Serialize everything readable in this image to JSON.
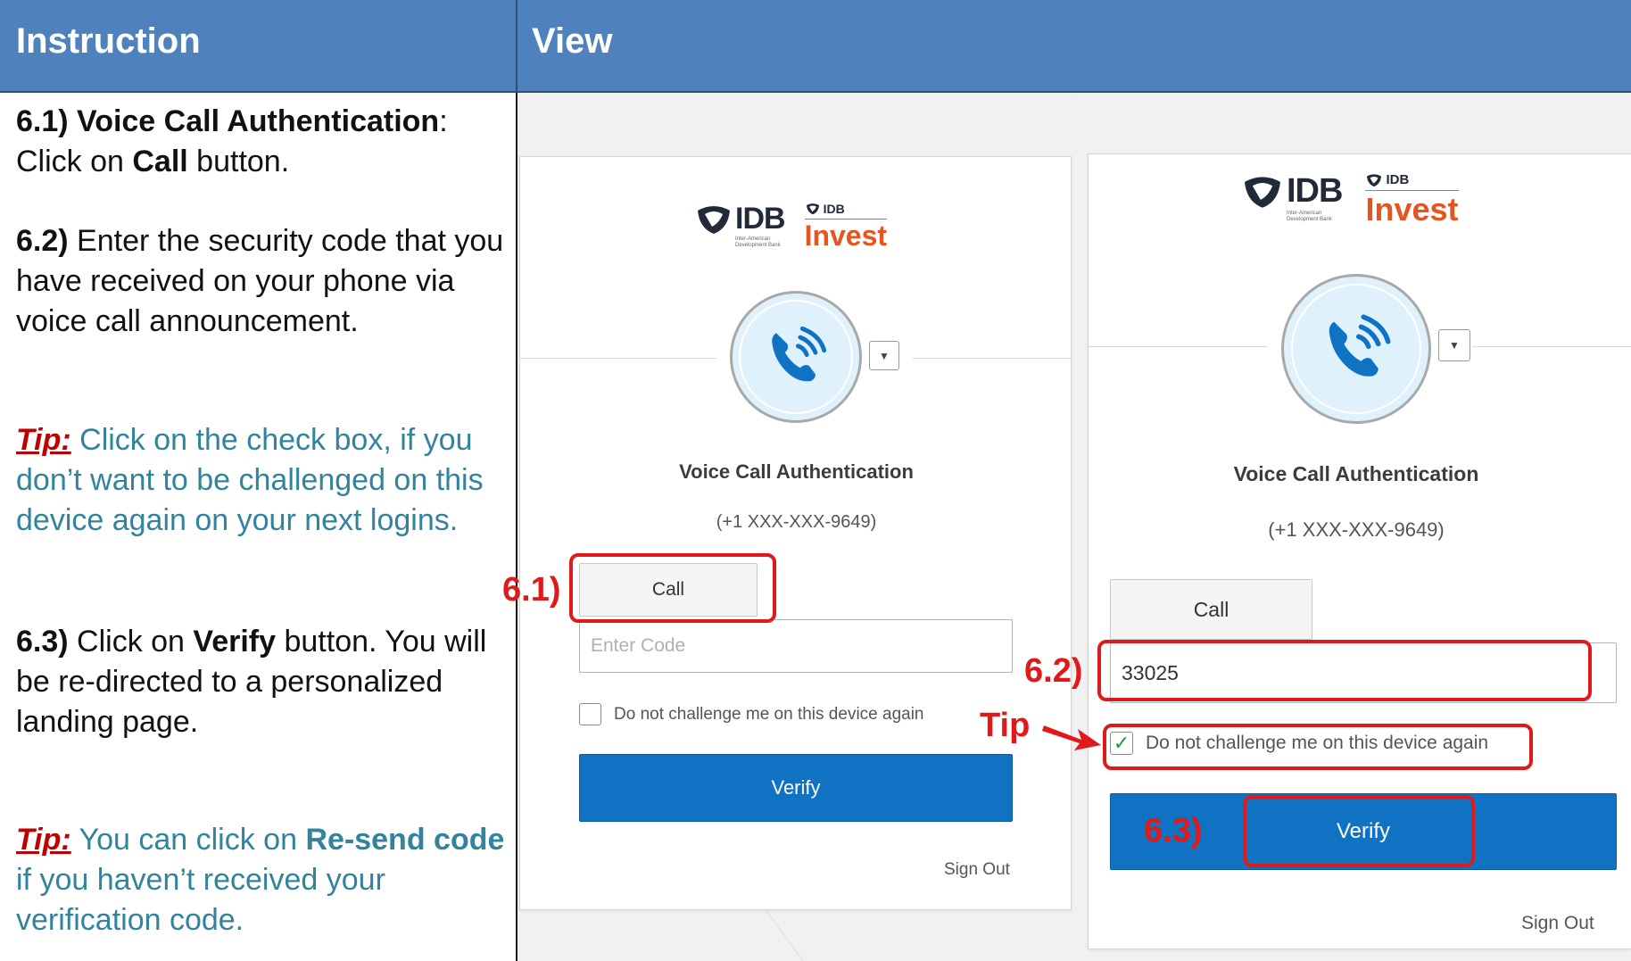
{
  "header": {
    "instruction": "Instruction",
    "view": "View"
  },
  "instructions": {
    "p1": {
      "step": "6.1) Voice Call Authentication",
      "colon": ":",
      "text1": "Click on ",
      "bold": "Call",
      "text2": " button."
    },
    "p2": {
      "step": "6.2)",
      "text": " Enter the security code that you have received on your phone via voice call announcement."
    },
    "p3": {
      "tip": "Tip:",
      "text": " Click on the check box, if you don’t want to be challenged on this device again on your next logins."
    },
    "p4": {
      "step": "6.3)",
      "text1": " Click on ",
      "bold": "Verify",
      "text2": " button. You will be re-directed to a personalized landing page."
    },
    "p5": {
      "tip": "Tip:",
      "text1": " You can click on ",
      "bold": "Re-send code",
      "text2": " if you haven’t received your verification code."
    }
  },
  "logo": {
    "idb": "IDB",
    "idb_sub1": "Inter-American",
    "idb_sub2": "Development Bank",
    "invest_top": "IDB",
    "invest": "Invest"
  },
  "card1": {
    "title": "Voice Call Authentication",
    "phone": "(+1 XXX-XXX-9649)",
    "call": "Call",
    "code_placeholder": "Enter Code",
    "remember": "Do not challenge me on this device again",
    "verify": "Verify",
    "signout": "Sign Out"
  },
  "card2": {
    "title": "Voice Call Authentication",
    "phone": "(+1 XXX-XXX-9649)",
    "call": "Call",
    "code_value": "33025",
    "remember": "Do not challenge me on this device again",
    "checkmark": "✓",
    "verify": "Verify",
    "signout": "Sign Out"
  },
  "annotations": {
    "a1": "6.1)",
    "a2": "6.2)",
    "a3": "6.3)",
    "tip": "Tip"
  },
  "colors": {
    "header": "#4f81bd",
    "tip_text": "#31849b",
    "tip_label": "#c00000",
    "highlight": "#e01a1a",
    "verify_button": "#0f72c2",
    "invest_orange": "#e8541d"
  }
}
